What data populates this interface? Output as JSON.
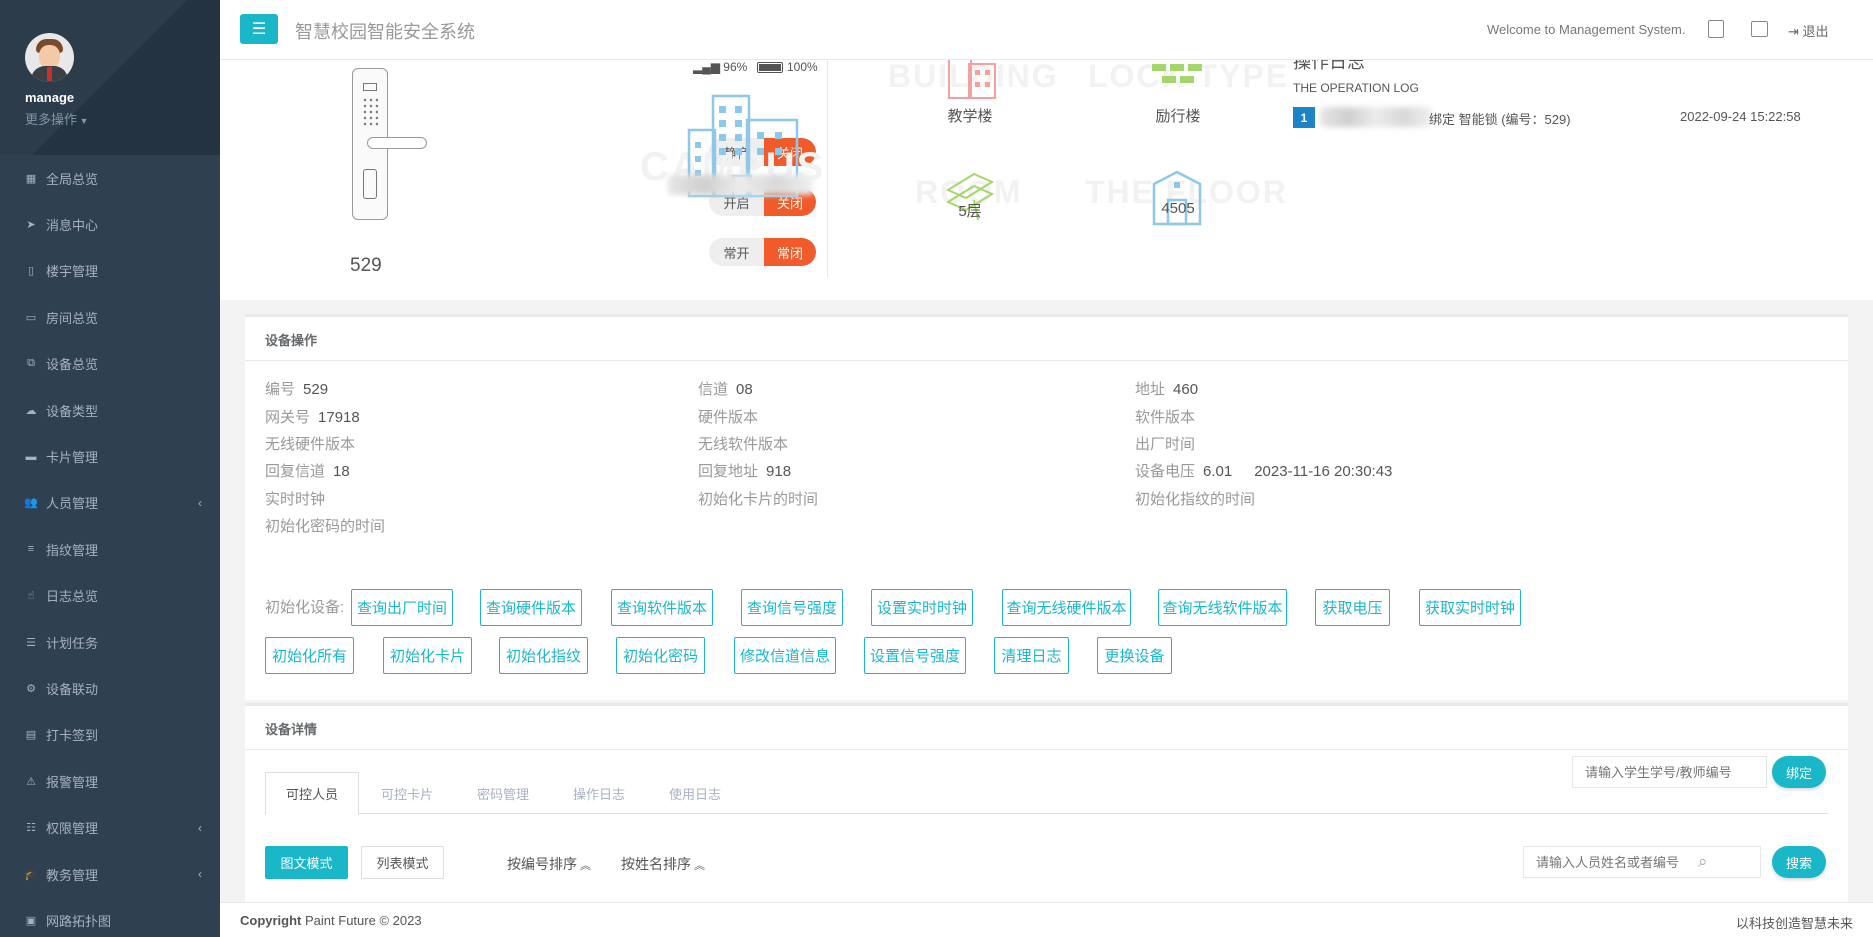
{
  "app": {
    "title": "智慧校园智能安全系统"
  },
  "user": {
    "name": "manage",
    "more": "更多操作"
  },
  "sidebar": {
    "items": [
      {
        "label": "全局总览",
        "icon": "dashboard-icon",
        "glyph": "▦"
      },
      {
        "label": "消息中心",
        "icon": "paper-plane-icon",
        "glyph": "➤"
      },
      {
        "label": "楼宇管理",
        "icon": "building-icon",
        "glyph": "▯"
      },
      {
        "label": "房间总览",
        "icon": "monitor-icon",
        "glyph": "▭"
      },
      {
        "label": "设备总览",
        "icon": "sitemap-icon",
        "glyph": "⧉"
      },
      {
        "label": "设备类型",
        "icon": "cloud-icon",
        "glyph": "☁"
      },
      {
        "label": "卡片管理",
        "icon": "credit-card-icon",
        "glyph": "▬"
      },
      {
        "label": "人员管理",
        "icon": "users-icon",
        "glyph": "👥",
        "arrow": true
      },
      {
        "label": "指纹管理",
        "icon": "bars-icon",
        "glyph": "≡"
      },
      {
        "label": "日志总览",
        "icon": "hand-icon",
        "glyph": "☝"
      },
      {
        "label": "计划任务",
        "icon": "list-icon",
        "glyph": "☰"
      },
      {
        "label": "设备联动",
        "icon": "cogs-icon",
        "glyph": "⚙"
      },
      {
        "label": "打卡签到",
        "icon": "card-icon",
        "glyph": "▤"
      },
      {
        "label": "报警管理",
        "icon": "warning-icon",
        "glyph": "⚠"
      },
      {
        "label": "权限管理",
        "icon": "sliders-icon",
        "glyph": "☷",
        "arrow": true
      },
      {
        "label": "教务管理",
        "icon": "mortarboard-icon",
        "glyph": "🎓",
        "arrow": true
      },
      {
        "label": "网路拓扑图",
        "icon": "image-icon",
        "glyph": "▣"
      }
    ]
  },
  "topbar": {
    "welcome": "Welcome to Management System.",
    "logout": "退出"
  },
  "device": {
    "number": "529",
    "signal": "96%",
    "battery": "100%",
    "battery_level": 1.0,
    "toggles": [
      {
        "key": "静音",
        "value": "关闭"
      },
      {
        "key": "开启",
        "value": "关闭"
      },
      {
        "key": "常开",
        "value": "常闭"
      }
    ]
  },
  "location": {
    "watermarks": [
      "CAMPUS",
      "BUILDING",
      "LOCK TYPE",
      "ROOM",
      "THE FLOOR"
    ],
    "building": "教学楼",
    "lock_type": "励行楼",
    "floor": "5层",
    "room": "4505"
  },
  "oplog": {
    "title": "操作日志",
    "subtitle": "THE OPERATION LOG",
    "entries": [
      {
        "index": "1",
        "text": "绑定 智能锁 (编号：529)",
        "time": "2022-09-24 15:22:58"
      }
    ]
  },
  "ops": {
    "title": "设备操作",
    "fields": [
      {
        "label": "编号",
        "value": "529"
      },
      {
        "label": "信道",
        "value": "08"
      },
      {
        "label": "地址",
        "value": "460"
      },
      {
        "label": "网关号",
        "value": "17918"
      },
      {
        "label": "硬件版本",
        "value": ""
      },
      {
        "label": "软件版本",
        "value": ""
      },
      {
        "label": "无线硬件版本",
        "value": ""
      },
      {
        "label": "无线软件版本",
        "value": ""
      },
      {
        "label": "出厂时间",
        "value": ""
      },
      {
        "label": "回复信道",
        "value": "18"
      },
      {
        "label": "回复地址",
        "value": "918"
      },
      {
        "label": "设备电压",
        "value": "6.01",
        "extra": "2023-11-16 20:30:43"
      },
      {
        "label": "实时时钟",
        "value": ""
      },
      {
        "label": "初始化卡片的时间",
        "value": ""
      },
      {
        "label": "初始化指纹的时间",
        "value": ""
      },
      {
        "label": "初始化密码的时间",
        "value": ""
      }
    ],
    "init_label": "初始化设备:",
    "buttons_row1": [
      "查询出厂时间",
      "查询硬件版本",
      "查询软件版本",
      "查询信号强度",
      "设置实时时钟",
      "查询无线硬件版本",
      "查询无线软件版本",
      "获取电压",
      "获取实时时钟"
    ],
    "buttons_row2": [
      "初始化所有",
      "初始化卡片",
      "初始化指纹",
      "初始化密码",
      "修改信道信息",
      "设置信号强度",
      "清理日志",
      "更换设备"
    ]
  },
  "details": {
    "title": "设备详情",
    "tabs": [
      "可控人员",
      "可控卡片",
      "密码管理",
      "操作日志",
      "使用日志"
    ],
    "bind_placeholder": "请输入学生学号/教师编号",
    "bind_button": "绑定",
    "mode_graphic": "图文模式",
    "mode_list": "列表模式",
    "sort_by_number": "按编号排序",
    "sort_by_name": "按姓名排序",
    "search_placeholder": "请输入人员姓名或者编号",
    "search_button": "搜索"
  },
  "footer": {
    "copyright_bold": "Copyright",
    "copyright_text": "Paint Future © 2023",
    "slogan": "以科技创造智慧未来"
  },
  "colors": {
    "sidebar": "#2f4050",
    "accent": "#1ab7c8",
    "toggle_on": "#f15a2b",
    "badge": "#1c84c6"
  }
}
